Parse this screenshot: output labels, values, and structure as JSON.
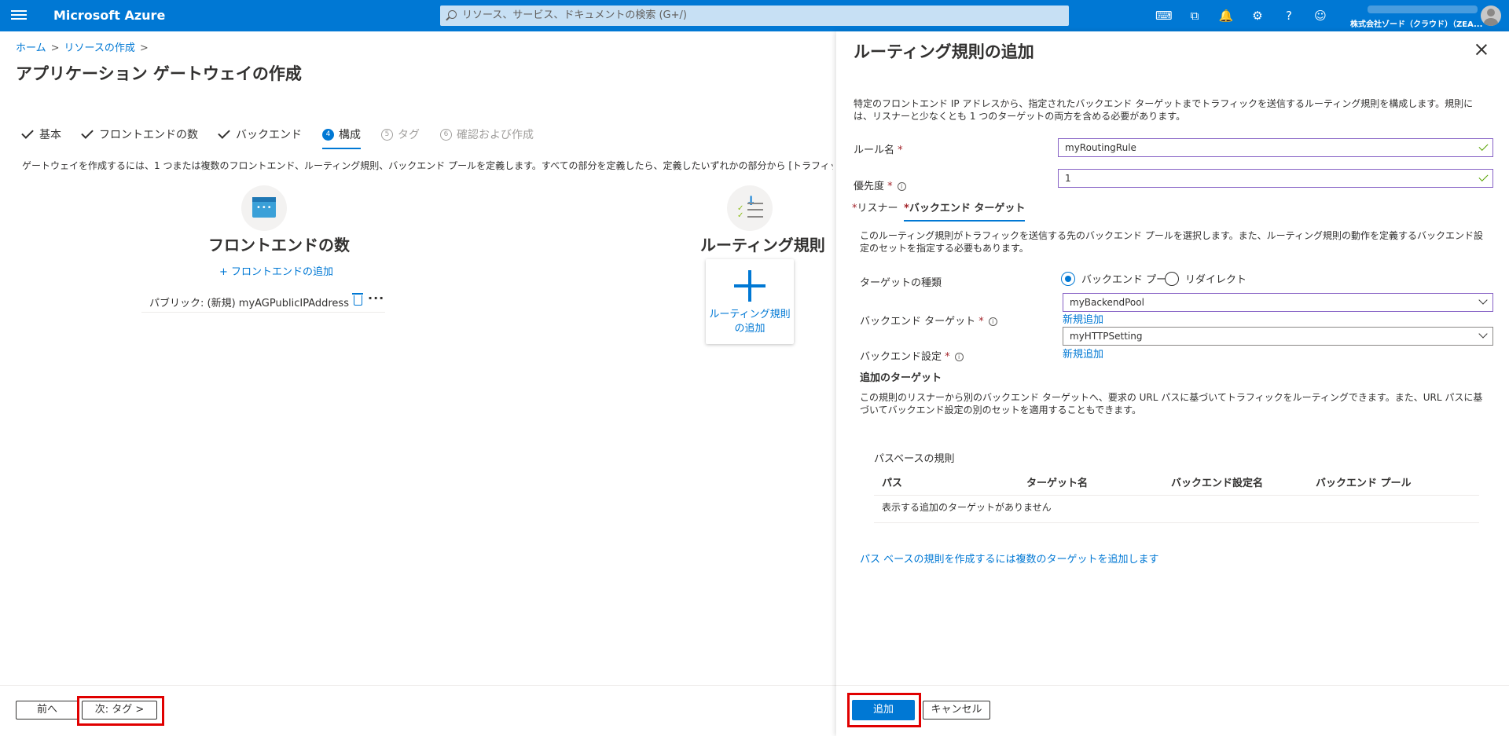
{
  "topbar": {
    "brand": "Microsoft Azure",
    "search_placeholder": "リソース、サービス、ドキュメントの検索 (G+/)",
    "tenant": "株式会社ゾード（クラウド）（ZEA...",
    "icons": [
      "cloud-shell-icon",
      "directory-filter-icon",
      "bell-icon",
      "gear-icon",
      "help-icon",
      "feedback-icon"
    ]
  },
  "breadcrumb": {
    "home": "ホーム",
    "create": "リソースの作成",
    "sep": ">"
  },
  "page": {
    "title": "アプリケーション ゲートウェイの作成",
    "ellipsis": "…",
    "steps": [
      {
        "label": "基本",
        "state": "done"
      },
      {
        "label": "フロントエンドの数",
        "state": "done"
      },
      {
        "label": "バックエンド",
        "state": "done"
      },
      {
        "num": "4",
        "label": "構成",
        "state": "active"
      },
      {
        "num": "5",
        "label": "タグ",
        "state": "disabled"
      },
      {
        "num": "6",
        "label": "確認および作成",
        "state": "disabled"
      }
    ],
    "description": "ゲートウェイを作成するには、1 つまたは複数のフロントエンド、ルーティング規則、バックエンド プールを定義します。すべての部分を定義したら、定義したいずれかの部分から [トラフィック フローの表示] を選択して",
    "frontend": {
      "title": "フロントエンドの数",
      "add_link": "+ フロントエンドの追加",
      "row_label": "パブリック: (新規) myAGPublicIPAddress",
      "more": "···"
    },
    "routing": {
      "title": "ルーティング規則",
      "add_card_label": "ルーティング規則の追加"
    },
    "footer": {
      "prev": "前へ",
      "next": "次: タグ >"
    }
  },
  "panel": {
    "title": "ルーティング規則の追加",
    "description": "特定のフロントエンド IP アドレスから、指定されたバックエンド ターゲットまでトラフィックを送信するルーティング規則を構成します。規則には、リスナーと少なくとも 1 つのターゲットの両方を含める必要があります。",
    "rule_name_label": "ルール名",
    "rule_name_value": "myRoutingRule",
    "priority_label": "優先度",
    "priority_value": "1",
    "required_mark": "*",
    "info_glyph": "i",
    "tabs": {
      "listener": "リスナー",
      "backend_targets": "バックエンド ターゲット"
    },
    "tab_description": "このルーティング規則がトラフィックを送信する先のバックエンド プールを選択します。また、ルーティング規則の動作を定義するバックエンド設定のセットを指定する必要もあります。",
    "target_type_label": "ターゲットの種類",
    "target_type_options": [
      "バックエンド プール",
      "リダイレクト"
    ],
    "target_type_selected": "バックエンド プール",
    "backend_target_label": "バックエンド ターゲット",
    "backend_target_value": "myBackendPool",
    "backend_settings_label": "バックエンド設定",
    "backend_settings_value": "myHTTPSetting",
    "new_link": "新規追加",
    "additional_title": "追加のターゲット",
    "additional_desc": "この規則のリスナーから別のバックエンド ターゲットへ、要求の URL パスに基づいてトラフィックをルーティングできます。また、URL パスに基づいてバックエンド設定の別のセットを適用することもできます。",
    "grid": {
      "title": "パスベースの規則",
      "columns": [
        "パス",
        "ターゲット名",
        "バックエンド設定名",
        "バックエンド プール"
      ],
      "empty": "表示する追加のターゲットがありません"
    },
    "multi_target_link": "パス ベースの規則を作成するには複数のターゲットを追加します",
    "footer": {
      "add": "追加",
      "cancel": "キャンセル"
    }
  },
  "colors": {
    "accent": "#0078d4",
    "highlight": "#e00000",
    "focus": "#8661c5"
  }
}
